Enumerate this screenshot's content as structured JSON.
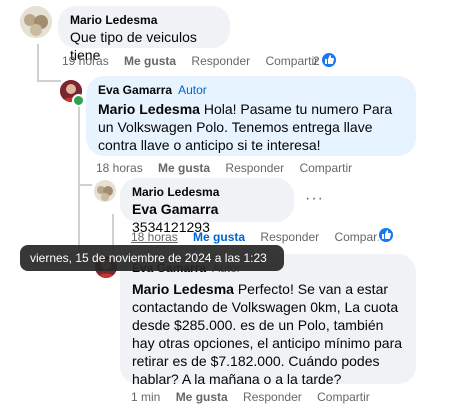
{
  "comments": [
    {
      "author": "Mario Ledesma",
      "text": "Que tipo de veiculos tiene",
      "actions": {
        "time": "19 horas",
        "like": "Me gusta",
        "reply": "Responder",
        "share": "Compartir"
      },
      "reaction_count": "2"
    },
    {
      "author": "Eva Gamarra",
      "badge": "Autor",
      "mention": "Mario Ledesma",
      "text": " Hola! Pasame tu numero Para un Volkswagen Polo. Tenemos entrega llave contra llave o anticipo si te interesa!",
      "actions": {
        "time": "18 horas",
        "like": "Me gusta",
        "reply": "Responder",
        "share": "Compartir"
      }
    },
    {
      "author": "Mario Ledesma",
      "mention": "Eva Gamarra",
      "text": " 3534121293",
      "actions": {
        "time": "18 horas",
        "like": "Me gusta",
        "reply": "Responder",
        "share": "Compartir"
      },
      "more": "···"
    },
    {
      "author": "Eva Gamarra",
      "badge": "Autor",
      "mention": "Mario Ledesma",
      "text": " Perfecto! Se van a estar contactando de Volkswagen 0km, La cuota desde $285.000. es de un Polo, también hay otras opciones, el anticipo mínimo para retirar es de $7.182.000. Cuándo podes hablar? A la mañana o a la tarde?",
      "actions": {
        "time": "1 min",
        "like": "Me gusta",
        "reply": "Responder",
        "share": "Compartir"
      }
    }
  ],
  "tooltip": "viernes, 15 de noviembre de 2024 a las 1:23 pm",
  "colors": {
    "bubble": "#f0f2f5",
    "author_bubble": "#e7f3ff",
    "link": "#0064d1",
    "meta": "#65676b",
    "like_blue": "#1877f2"
  },
  "icons": [
    "avatar-mario",
    "avatar-eva",
    "like-reaction-icon",
    "more-options-icon"
  ]
}
